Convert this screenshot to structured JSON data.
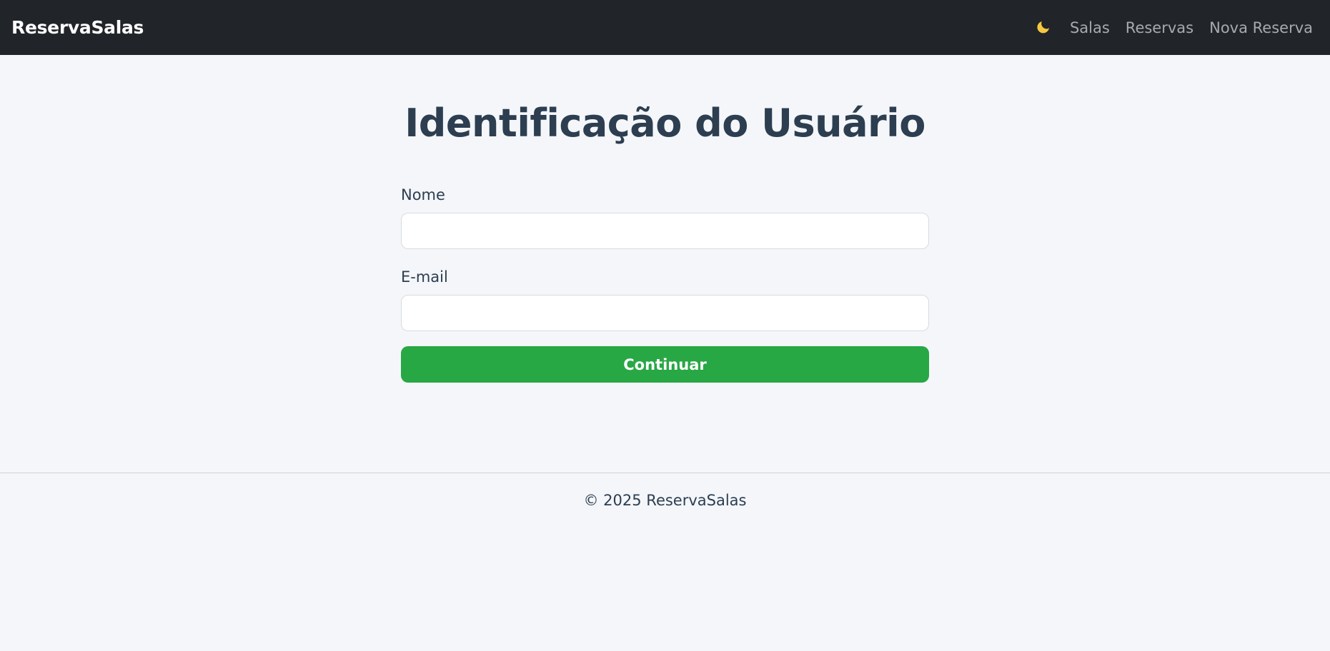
{
  "navbar": {
    "brand": "ReservaSalas",
    "theme_toggle_icon": "moon-icon",
    "links": [
      {
        "label": "Salas"
      },
      {
        "label": "Reservas"
      },
      {
        "label": "Nova Reserva"
      }
    ]
  },
  "main": {
    "title": "Identificação do Usuário",
    "form": {
      "name_label": "Nome",
      "name_value": "",
      "email_label": "E-mail",
      "email_value": "",
      "submit_label": "Continuar"
    }
  },
  "footer": {
    "text": "© 2025 ReservaSalas"
  },
  "colors": {
    "navbar_bg": "#212529",
    "page_bg": "#f4f6fa",
    "primary_button": "#28a745",
    "title_text": "#2c3e50",
    "moon_icon": "#f5c842"
  }
}
